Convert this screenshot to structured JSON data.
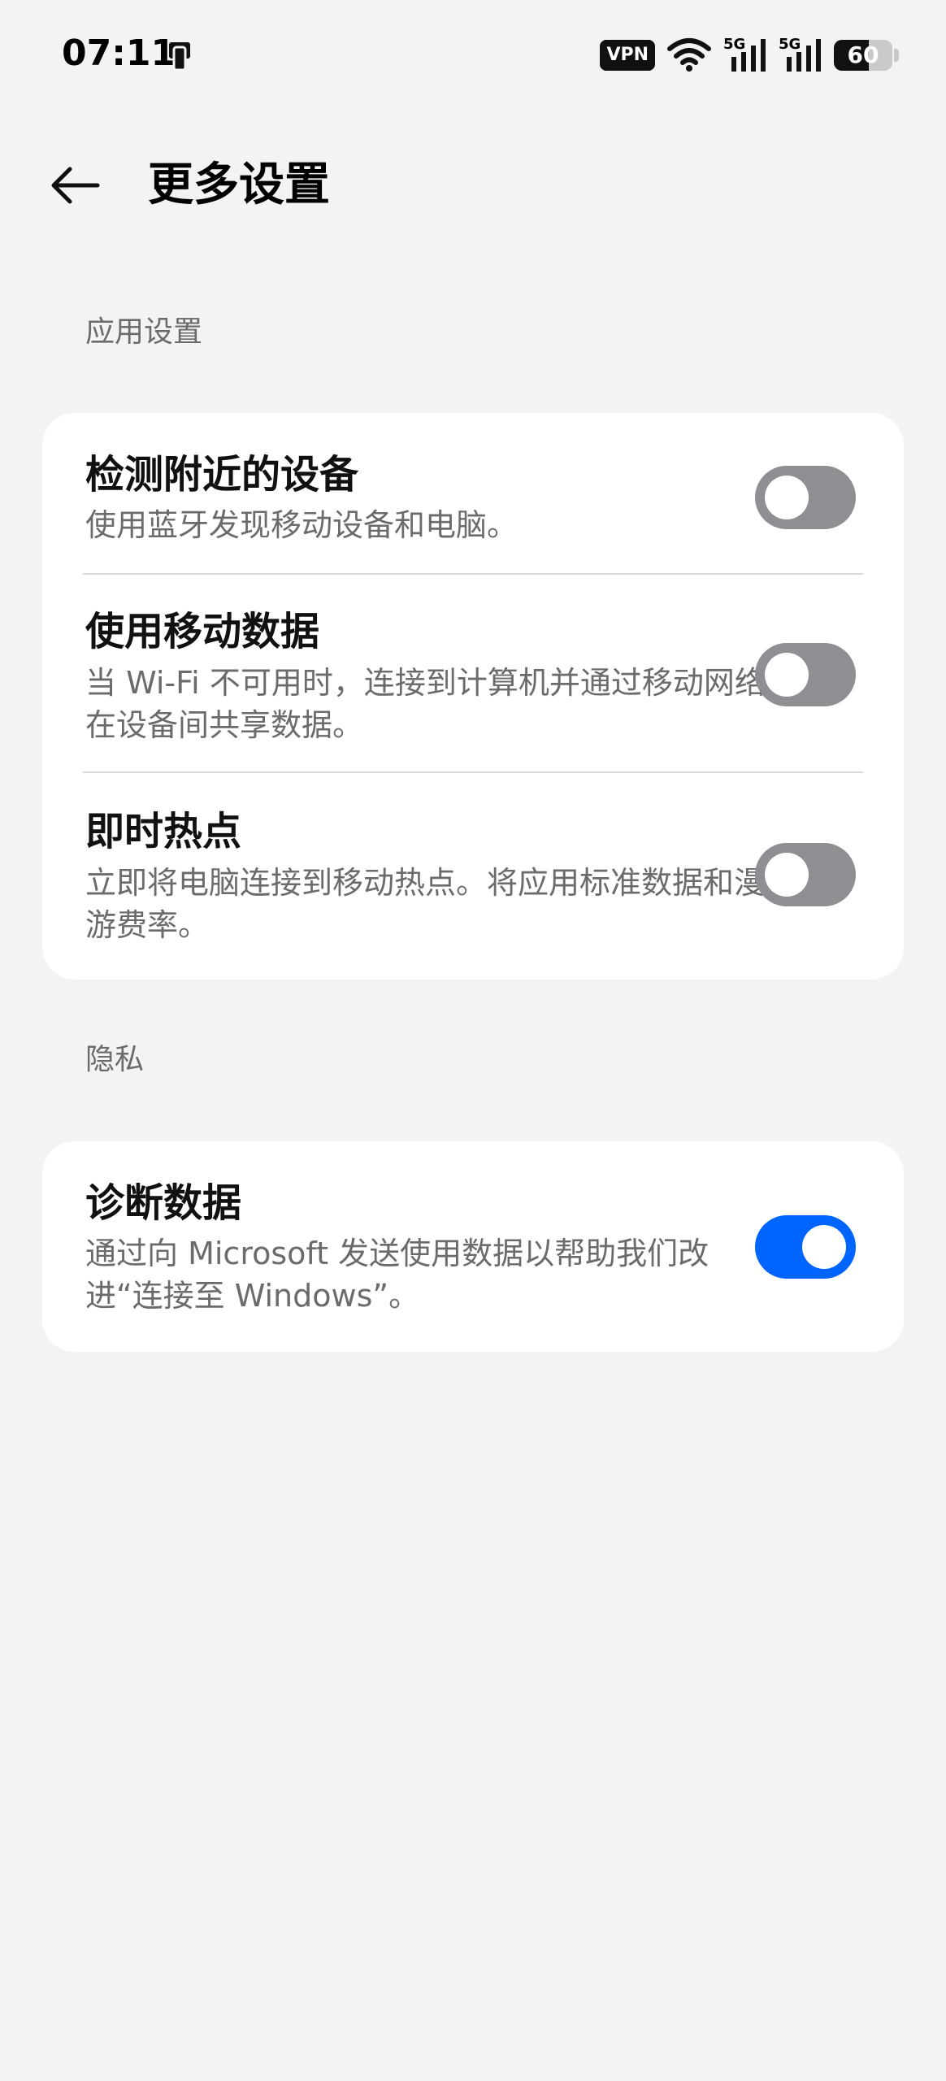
{
  "status_bar": {
    "time": "07:11",
    "vpn_label": "VPN",
    "network_1": "5G",
    "network_2": "5G",
    "battery_percent": "60",
    "battery_level": 0.6
  },
  "header": {
    "title": "更多设置"
  },
  "sections": [
    {
      "title": "应用设置",
      "items": [
        {
          "title": "检测附近的设备",
          "description": "使用蓝牙发现移动设备和电脑。",
          "enabled": false
        },
        {
          "title": "使用移动数据",
          "description": "当 Wi-Fi 不可用时，连接到计算机并通过移动网络在设备间共享数据。",
          "enabled": false
        },
        {
          "title": "即时热点",
          "description": "立即将电脑连接到移动热点。将应用标准数据和漫游费率。",
          "enabled": false
        }
      ]
    },
    {
      "title": "隐私",
      "items": [
        {
          "title": "诊断数据",
          "description": "通过向 Microsoft 发送使用数据以帮助我们改进“连接至 Windows”。",
          "enabled": true
        }
      ]
    }
  ],
  "colors": {
    "background": "#f2f3f5",
    "card": "#ffffff",
    "toggle_off": "#8e8e93",
    "toggle_on": "#0064ff",
    "secondary_text": "#6b6b6b"
  }
}
